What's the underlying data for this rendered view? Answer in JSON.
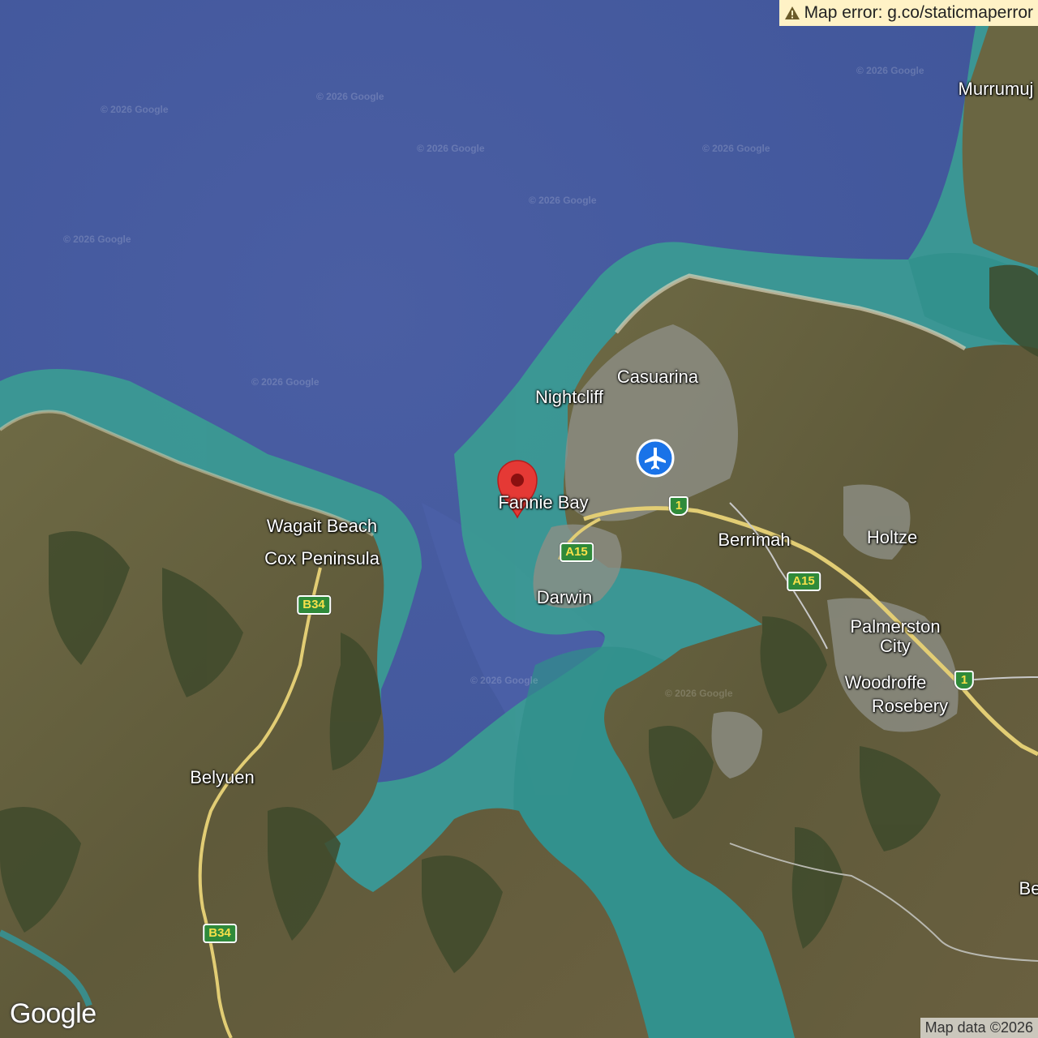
{
  "error_banner": {
    "text": "Map error: g.co/staticmaperror",
    "icon": "warning-icon"
  },
  "attribution": "Map data ©2026",
  "logo": "Google",
  "watermark": "© 2026 Google",
  "places": {
    "murrumujuk": "Murrumuj",
    "casuarina": "Casuarina",
    "nightcliff": "Nightcliff",
    "fannie_bay": "Fannie Bay",
    "berrimah": "Berrimah",
    "holtze": "Holtze",
    "wagait_beach": "Wagait Beach",
    "cox_peninsula": "Cox Peninsula",
    "darwin": "Darwin",
    "palmerston_city": "Palmerston City",
    "woodroffe": "Woodroffe",
    "rosebery": "Rosebery",
    "belyuen": "Belyuen",
    "be_edge": "Be"
  },
  "road_shields": {
    "a15_west": "A15",
    "a15_east": "A15",
    "nat1_north": "1",
    "nat1_east": "1",
    "b34_north": "B34",
    "b34_south": "B34"
  },
  "markers": {
    "pin": "map-pin-icon",
    "airport": "airport-icon"
  },
  "colors": {
    "sea": "#46599c",
    "shallows": "#3f9a94",
    "land": "#6b6640",
    "road": "#e8d27a",
    "pin": "#e53935",
    "airport": "#1a73e8"
  }
}
